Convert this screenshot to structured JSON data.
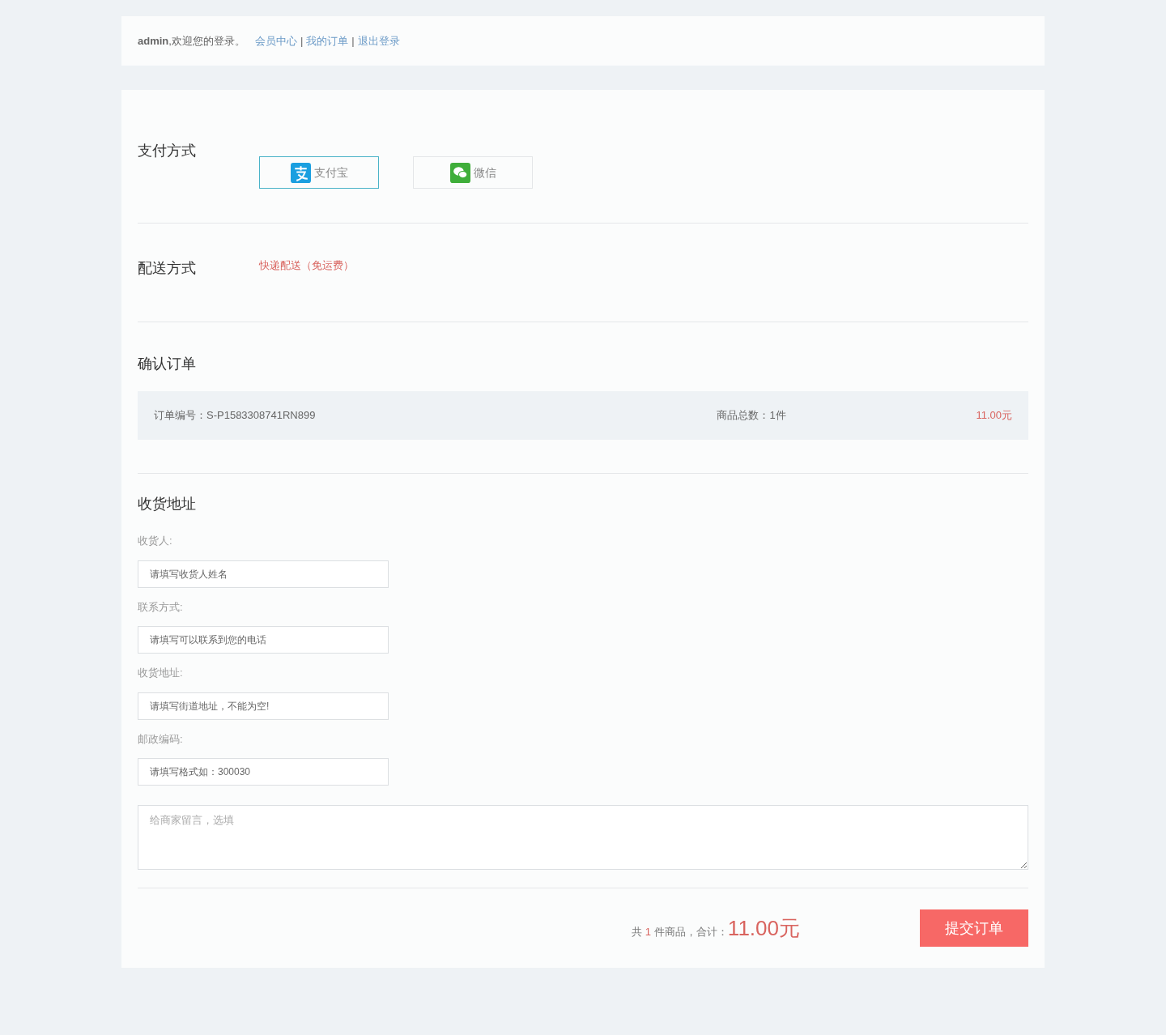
{
  "header": {
    "user": "admin",
    "welcome": ",欢迎您的登录。",
    "links": [
      "会员中心",
      "我的订单",
      "退出登录"
    ],
    "separator": "|"
  },
  "payment": {
    "title": "支付方式",
    "options": [
      {
        "kind": "alipay",
        "label": "支付宝",
        "selected": true
      },
      {
        "kind": "wechat",
        "label": "微信",
        "selected": false
      }
    ]
  },
  "delivery": {
    "title": "配送方式",
    "method": "快递配送（免运费）"
  },
  "order": {
    "title": "确认订单",
    "number": "订单编号：S-P1583308741RN899",
    "count": "商品总数：1件",
    "price": "11.00元"
  },
  "address": {
    "title": "收货地址",
    "fields": [
      {
        "label": "收货人:",
        "placeholder": "请填写收货人姓名"
      },
      {
        "label": "联系方式:",
        "placeholder": "请填写可以联系到您的电话"
      },
      {
        "label": "收货地址:",
        "placeholder": "请填写街道地址，不能为空!"
      },
      {
        "label": "邮政编码:",
        "placeholder": "请填写格式如：300030"
      }
    ],
    "message_placeholder": "给商家留言，选填"
  },
  "summary": {
    "prefix": "共",
    "count": "1",
    "middle": "件商品，合计：",
    "total": "11.00元",
    "submit": "提交订单"
  }
}
